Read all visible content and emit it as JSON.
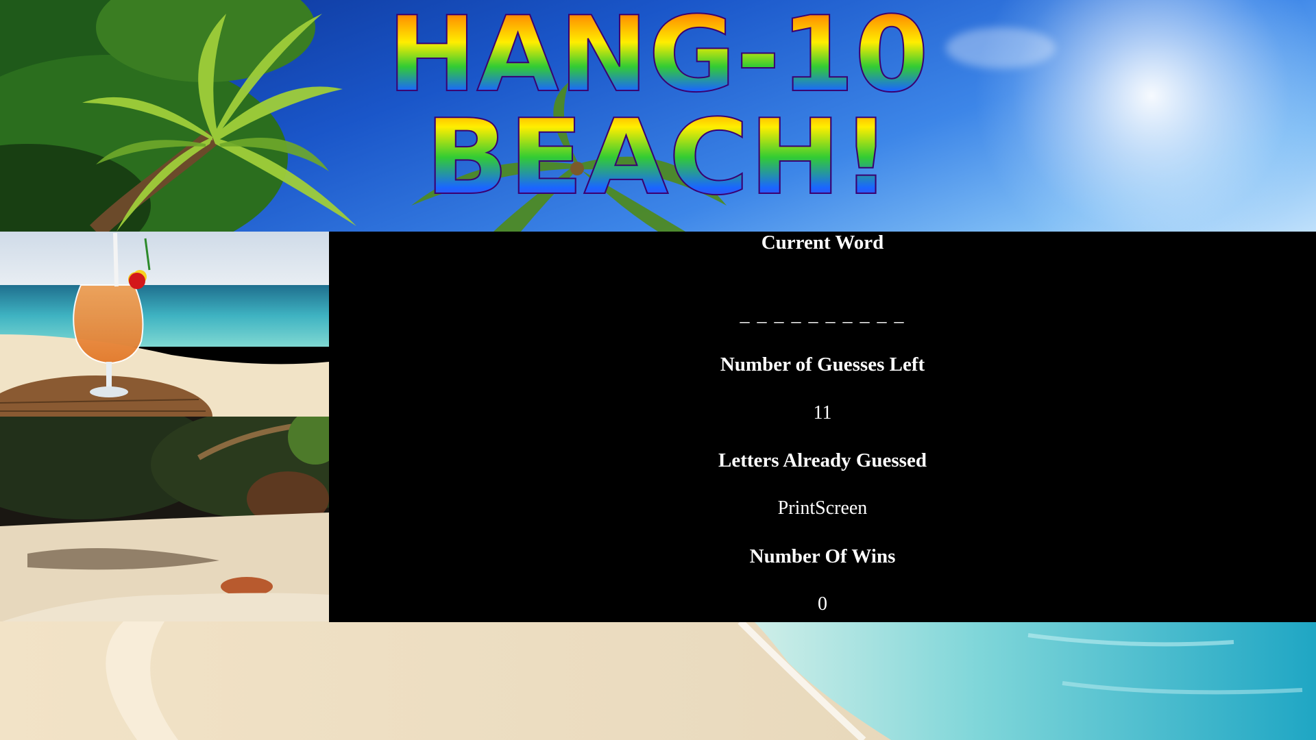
{
  "header": {
    "title_line_1": "HANG-10",
    "title_line_2": "BEACH!",
    "title_gradient": [
      "#ff1a1a",
      "#ff9900",
      "#ffee00",
      "#33cc33",
      "#1a66ff",
      "#6a1acc"
    ]
  },
  "images": {
    "header_background": "tropical-palm-tree-sky",
    "left_top": "tropical-drink-on-beach",
    "left_bottom": "shaded-tropical-beach",
    "bottom_banner": "sandy-beach-turquoise-water"
  },
  "game": {
    "current_word_label": "Current Word",
    "current_word_display": "_ _ _ _ _ _ _ _ _ _",
    "guesses_left_label": "Number of Guesses Left",
    "guesses_left_value": "11",
    "letters_guessed_label": "Letters Already Guessed",
    "letters_guessed_value": "PrintScreen",
    "wins_label": "Number Of Wins",
    "wins_value": "0"
  },
  "colors": {
    "panel_background": "#000000",
    "panel_text": "#ffffff",
    "sky_blue": "#1a56c9",
    "ocean_turquoise": "#3fc1d6",
    "sand": "#efe0c0"
  }
}
